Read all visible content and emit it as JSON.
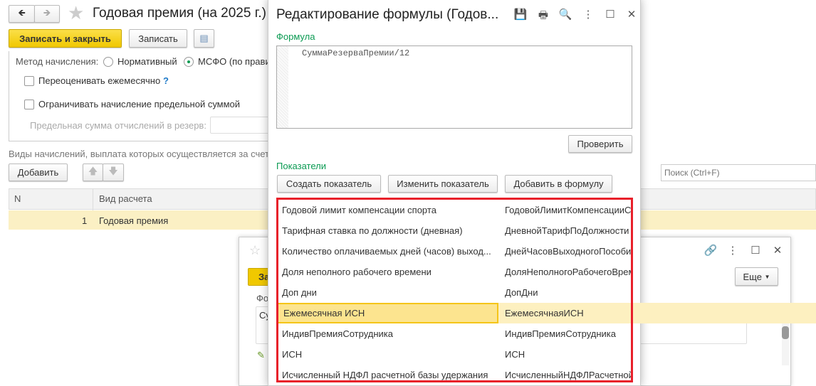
{
  "main": {
    "title": "Годовая премия (на 2025 г.)",
    "save_close": "Записать и закрыть",
    "save": "Записать",
    "method_label": "Метод начисления:",
    "method_opt1": "Нормативный",
    "method_opt2": "МСФО (по прави",
    "revalue": "Переоценивать ежемесячно",
    "help": "?",
    "limit": "Ограничивать начисление предельной суммой",
    "limit_sum": "Предельная сумма отчислений в резерв:",
    "kinds_text": "Виды начислений, выплата которых осуществляется за счет",
    "add": "Добавить",
    "search_placeholder": "Поиск (Ctrl+F)",
    "col_n": "N",
    "col_kind": "Вид расчета",
    "row_n": "1",
    "row_kind": "Годовая премия"
  },
  "second": {
    "save_partial": "За",
    "more": "Еще",
    "field_partial": "Фо",
    "text_partial": "Су"
  },
  "dialog": {
    "title": "Редактирование формулы (Годов...",
    "formula_label": "Формула",
    "formula": "СуммаРезерваПремии/12",
    "check": "Проверить",
    "indicators_label": "Показатели",
    "create": "Создать показатель",
    "change": "Изменить показатель",
    "add_to_formula": "Добавить в формулу",
    "highlight_color": "#e8202a",
    "rows": [
      {
        "name": "Годовой лимит компенсации спорта",
        "id": "ГодовойЛимитКомпенсацииСпорта"
      },
      {
        "name": "Тарифная ставка по должности (дневная)",
        "id": "ДневнойТарифПоДолжности"
      },
      {
        "name": "Количество оплачиваемых дней (часов) выход...",
        "id": "ДнейЧасовВыходногоПособия"
      },
      {
        "name": "Доля неполного рабочего времени",
        "id": "ДоляНеполногоРабочегоВремени"
      },
      {
        "name": "Доп дни",
        "id": "ДопДни"
      },
      {
        "name": "Ежемесячная ИСН",
        "id": "ЕжемесячнаяИСН"
      },
      {
        "name": "ИндивПремияСотрудника",
        "id": "ИндивПремияСотрудника"
      },
      {
        "name": "ИСН",
        "id": "ИСН"
      },
      {
        "name": "Исчисленный НДФЛ расчетной базы удержания",
        "id": "ИсчисленныйНДФЛРасчетнойБазы"
      }
    ]
  }
}
